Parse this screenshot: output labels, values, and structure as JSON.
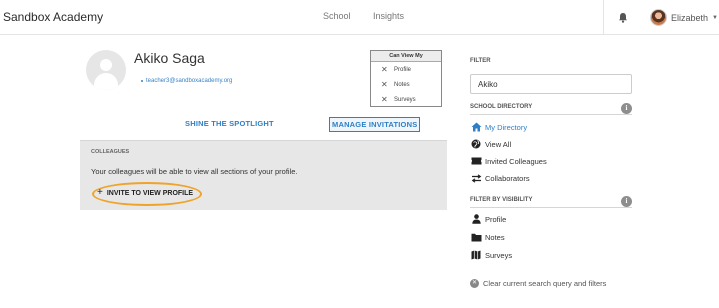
{
  "navbar": {
    "brand": "Sandbox Academy",
    "links": [
      "School",
      "Insights"
    ],
    "user_name": "Elizabeth",
    "icons": {
      "notifications": "bell-icon",
      "caret": "chevron-down-icon"
    }
  },
  "profile": {
    "name": "Akiko Saga",
    "email": "teacher3@sandboxacademy.org"
  },
  "can_view": {
    "title": "Can View My",
    "items": [
      "Profile",
      "Notes",
      "Surveys"
    ]
  },
  "tabs": {
    "spotlight": "SHINE THE SPOTLIGHT",
    "invitations": "MANAGE INVITATIONS"
  },
  "colleagues": {
    "title": "COLLEAGUES",
    "description": "Your colleagues will be able to view all sections of your profile.",
    "invite_label": "INVITE TO VIEW PROFILE",
    "highlight_color": "#f0a32a"
  },
  "sidebar": {
    "filter_label": "FILTER",
    "filter_value": "Akiko",
    "directory_label": "SCHOOL DIRECTORY",
    "directory_items": [
      {
        "label": "My Directory",
        "icon": "home-icon",
        "active": true
      },
      {
        "label": "View All",
        "icon": "globe-icon",
        "active": false
      },
      {
        "label": "Invited Colleagues",
        "icon": "ticket-icon",
        "active": false
      },
      {
        "label": "Collaborators",
        "icon": "swap-arrows-icon",
        "active": false
      }
    ],
    "visibility_label": "FILTER BY VISIBILITY",
    "visibility_items": [
      {
        "label": "Profile",
        "icon": "person-icon"
      },
      {
        "label": "Notes",
        "icon": "folder-icon"
      },
      {
        "label": "Surveys",
        "icon": "map-icon"
      }
    ],
    "clear_label": "Clear current search query and filters",
    "accent_color": "#2f7fc6"
  }
}
